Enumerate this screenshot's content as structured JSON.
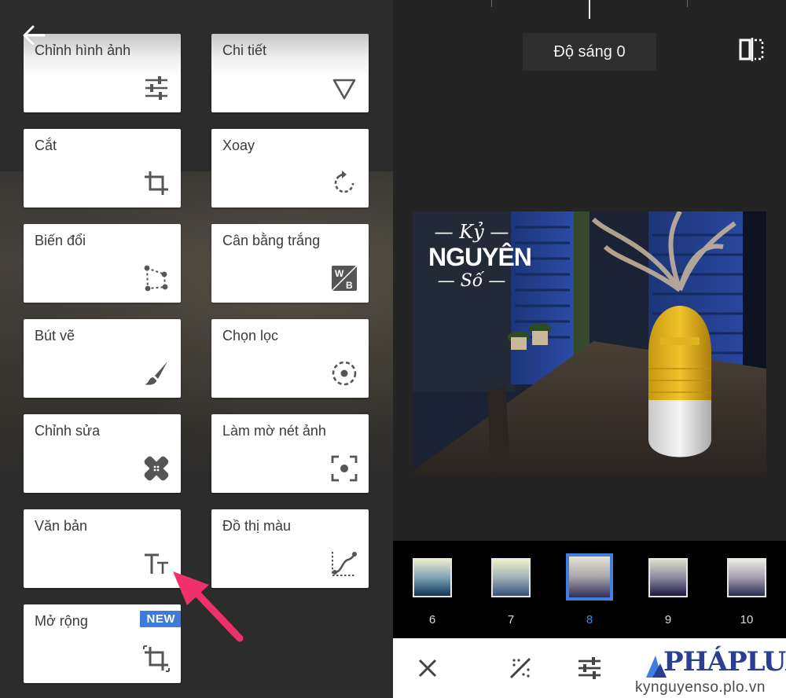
{
  "tools": [
    {
      "label": "Chỉnh hình ảnh",
      "icon": "tune-sliders-icon"
    },
    {
      "label": "Chi tiết",
      "icon": "triangle-details-icon"
    },
    {
      "label": "Cắt",
      "icon": "crop-icon"
    },
    {
      "label": "Xoay",
      "icon": "rotate-icon"
    },
    {
      "label": "Biến đổi",
      "icon": "perspective-icon"
    },
    {
      "label": "Cân bằng trắng",
      "icon": "white-balance-icon"
    },
    {
      "label": "Bút vẽ",
      "icon": "brush-icon"
    },
    {
      "label": "Chọn lọc",
      "icon": "selective-icon"
    },
    {
      "label": "Chỉnh sửa",
      "icon": "healing-icon"
    },
    {
      "label": "Làm mờ nét ảnh",
      "icon": "vignette-focus-icon"
    },
    {
      "label": "Văn bản",
      "icon": "text-icon"
    },
    {
      "label": "Đồ thị màu",
      "icon": "curves-icon"
    },
    {
      "label": "Mở rộng",
      "icon": "expand-icon",
      "badge": "NEW"
    }
  ],
  "editor": {
    "adjustment": "Độ sáng 0",
    "watermark": {
      "line1": "Kỷ",
      "line2": "NGUYÊN",
      "line3": "Số"
    }
  },
  "filters": [
    {
      "num": "6",
      "selected": false
    },
    {
      "num": "7",
      "selected": false
    },
    {
      "num": "8",
      "selected": true
    },
    {
      "num": "9",
      "selected": false
    },
    {
      "num": "10",
      "selected": false
    }
  ],
  "branding": {
    "logo": "PHÁPLUẬT",
    "site": "kynguyenso.plo.vn"
  },
  "colors": {
    "accent": "#3f7fe0",
    "arrow": "#f0306a",
    "badge": "#3d7ad9"
  }
}
